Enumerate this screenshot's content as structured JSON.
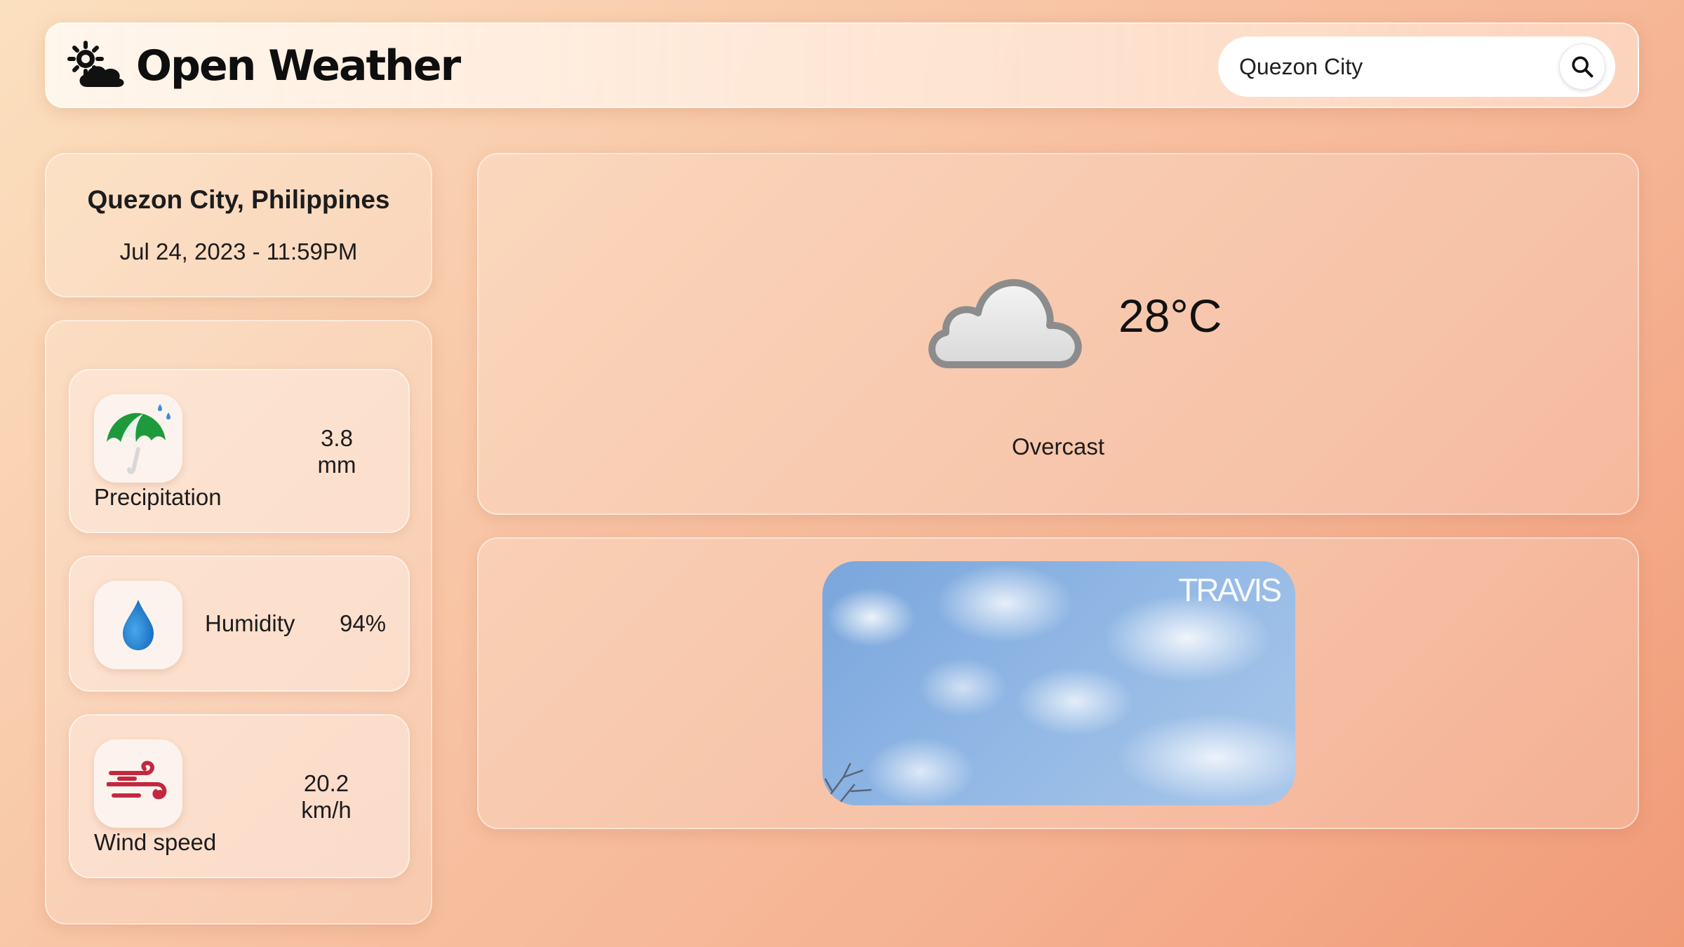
{
  "header": {
    "app_title": "Open Weather",
    "logo_icon": "sun-cloud-icon",
    "search": {
      "value": "Quezon City",
      "placeholder": "Search city",
      "button_icon": "search-icon"
    }
  },
  "location": {
    "name": "Quezon City, Philippines",
    "datetime": "Jul 24, 2023 - 11:59PM"
  },
  "metrics": [
    {
      "label": "Precipitation",
      "value": "3.8",
      "unit": "mm",
      "icon": "umbrella-rain-icon"
    },
    {
      "label": "Humidity",
      "value": "94%",
      "icon": "water-drop-icon"
    },
    {
      "label": "Wind speed",
      "value": "20.2",
      "unit": "km/h",
      "icon": "wind-icon"
    }
  ],
  "current": {
    "temperature": "28°C",
    "condition": "Overcast",
    "icon": "cloud-icon"
  },
  "media": {
    "brand_text": "TRAVIS"
  },
  "colors": {
    "background_start": "#fbe0bf",
    "background_end": "#f19a76",
    "text": "#1c1c1c"
  }
}
